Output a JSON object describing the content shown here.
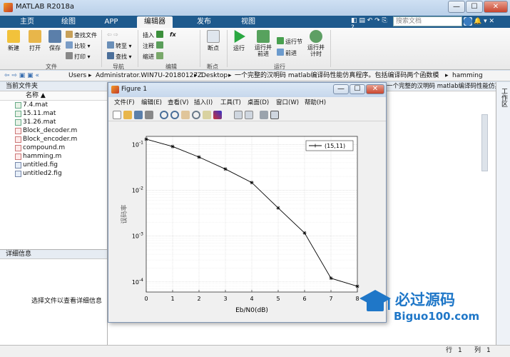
{
  "window": {
    "title": "MATLAB R2018a",
    "minimize": "—",
    "maximize": "☐",
    "close": "✕"
  },
  "tabs": [
    "主页",
    "绘图",
    "APP",
    "编辑器",
    "发布",
    "视图"
  ],
  "search": {
    "placeholder": "搜索文档"
  },
  "ribbon": {
    "file": {
      "new": "新建",
      "open": "打开",
      "save": "保存",
      "find_files": "查找文件",
      "compare": "比较",
      "print": "打印",
      "group": "文件"
    },
    "nav": {
      "goto": "转至",
      "find": "查找",
      "group": "导航"
    },
    "edit": {
      "insert": "插入",
      "comment": "注释",
      "indent": "缩进",
      "fx": "fx",
      "group": "编辑"
    },
    "breakpoints": {
      "label": "断点",
      "group": "断点"
    },
    "run": {
      "run": "运行",
      "run_advance": "运行并\n前进",
      "run_section": "运行节",
      "advance": "前进",
      "run_time": "运行并\n计时",
      "group": "运行"
    }
  },
  "address": {
    "path": [
      "Users",
      "Administrator.WIN7U-20180127Z",
      "Desktop",
      "一个完整的汉明码 matlab编译码性能仿真程序。包括编译码两个函数模块",
      "hamming"
    ]
  },
  "current_folder": {
    "title": "当前文件夹",
    "column": "名称 ▲",
    "files": [
      "7.4.mat",
      "15.11.mat",
      "31.26.mat",
      "Block_decoder.m",
      "Block_encoder.m",
      "compound.m",
      "hamming.m",
      "untitled.fig",
      "untitled2.fig"
    ]
  },
  "details": {
    "title": "详细信息",
    "message": "选择文件以查看详细信息"
  },
  "right_panel": {
    "text": "一个完整的汉明码 matlab编译码性能仿真程序。包括编译码两个...",
    "workspace": "工作区"
  },
  "figure": {
    "title": "Figure 1",
    "menu": [
      "文件(F)",
      "编辑(E)",
      "查看(V)",
      "插入(I)",
      "工具(T)",
      "桌面(D)",
      "窗口(W)",
      "帮助(H)"
    ]
  },
  "chart_data": {
    "type": "line",
    "title": "",
    "xlabel": "Eb/N0(dB)",
    "ylabel": "误码率",
    "yscale": "log",
    "xlim": [
      0,
      8
    ],
    "ylim": [
      6e-05,
      0.15
    ],
    "xticks": [
      "0",
      "1",
      "2",
      "3",
      "4",
      "5",
      "6",
      "7",
      "8"
    ],
    "yticks": [
      "10^-4",
      "10^-3",
      "10^-2",
      "10^-1"
    ],
    "grid": true,
    "legend_position": "top-right",
    "series": [
      {
        "name": "(15,11)",
        "marker": "star",
        "color": "#000000",
        "x": [
          0,
          1,
          2,
          3,
          4,
          5,
          6,
          7,
          8
        ],
        "y": [
          0.13,
          0.09,
          0.053,
          0.029,
          0.0147,
          0.0041,
          0.00117,
          0.00012,
          8e-05
        ]
      }
    ]
  },
  "status": {
    "row_label": "行",
    "row": "1",
    "col_label": "列",
    "col": "1"
  },
  "watermark": {
    "cn": "必过源码",
    "url": "Biguo100.com"
  }
}
